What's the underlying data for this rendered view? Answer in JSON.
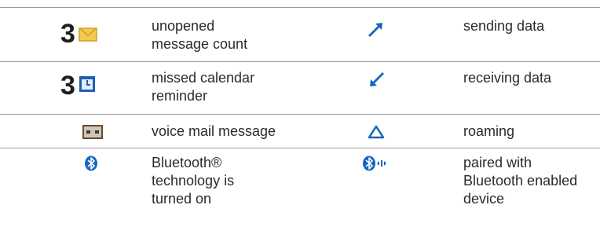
{
  "rows": [
    {
      "left_icon": "envelope-icon",
      "left_count": "3",
      "left_text": [
        "unopened",
        "message count"
      ],
      "right_icon": "arrow-up-right-icon",
      "right_text": [
        "sending data"
      ]
    },
    {
      "left_icon": "calendar-icon",
      "left_count": "3",
      "left_text": [
        "missed calendar",
        "reminder"
      ],
      "right_icon": "arrow-down-left-icon",
      "right_text": [
        "receiving data"
      ]
    },
    {
      "left_icon": "voicemail-icon",
      "left_text": [
        "voice mail message"
      ],
      "right_icon": "roaming-triangle-icon",
      "right_text": [
        "roaming"
      ]
    },
    {
      "left_icon": "bluetooth-icon",
      "left_text": [
        "Bluetooth®",
        "technology is",
        "turned on"
      ],
      "right_icon": "bluetooth-paired-icon",
      "right_text": [
        "paired with",
        "Bluetooth enabled",
        "device"
      ]
    }
  ],
  "colors": {
    "envelope_fill": "#f2c94c",
    "blue_icon": "#1565c0",
    "voicemail_frame": "#6b4a2b",
    "rule": "#9a9a9a"
  }
}
